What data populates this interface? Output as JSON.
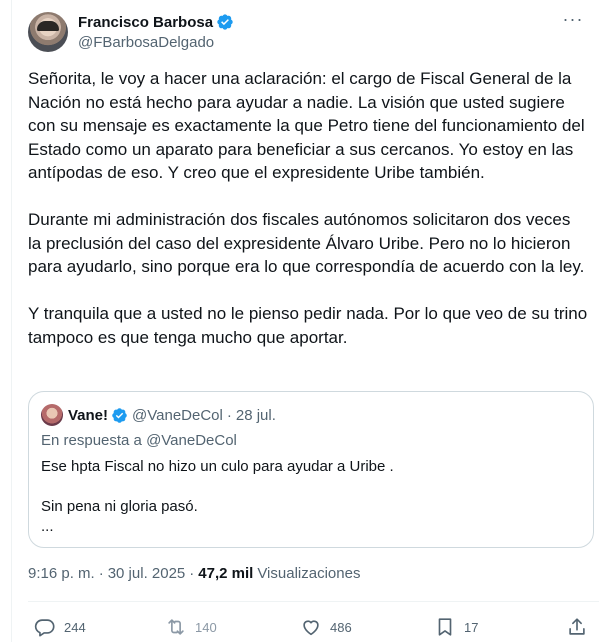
{
  "author": {
    "display_name": "Francisco Barbosa",
    "handle": "@FBarbosaDelgado"
  },
  "tweet": {
    "paragraphs": [
      "Señorita, le voy a hacer una aclaración: el cargo de Fiscal General de la Nación no está hecho para ayudar a nadie. La visión que usted sugiere con su mensaje es exactamente la que Petro tiene del funcionamiento del Estado como un aparato para beneficiar a sus cercanos. Yo estoy en las antípodas de eso. Y creo que el expresidente Uribe también.",
      "Durante mi administración dos fiscales autónomos solicitaron dos veces la preclusión del caso del expresidente Álvaro Uribe. Pero no lo hicieron para ayudarlo, sino porque era lo que correspondía de acuerdo con la ley.",
      "Y tranquila que a usted no le pienso pedir nada. Por lo que veo de su trino tampoco es que tenga mucho que aportar."
    ]
  },
  "quote": {
    "display_name": "Vane!",
    "handle": "@VaneDeCol",
    "separator": "·",
    "date": "28 jul.",
    "reply_to": "En respuesta a @VaneDeCol",
    "lines": [
      "Ese hpta Fiscal no hizo un culo para ayudar a Uribe .",
      "",
      "Sin pena ni gloria pasó.",
      "..."
    ]
  },
  "meta": {
    "time": "9:16 p. m.",
    "separator": "·",
    "date": "30 jul. 2025",
    "separator2": "·",
    "views_count": "47,2 mil",
    "views_label": "Visualizaciones"
  },
  "actions": {
    "replies": "244",
    "reposts": "140",
    "likes": "486",
    "bookmarks": "17"
  },
  "colors": {
    "verified": "#1d9bf0",
    "secondary_text": "#536471",
    "border": "#cfd9de"
  },
  "icons": {
    "more": "more-dots-icon",
    "verified": "verified-badge-icon",
    "reply": "reply-icon",
    "repost": "repost-icon",
    "like": "heart-icon",
    "bookmark": "bookmark-icon",
    "share": "share-icon"
  }
}
